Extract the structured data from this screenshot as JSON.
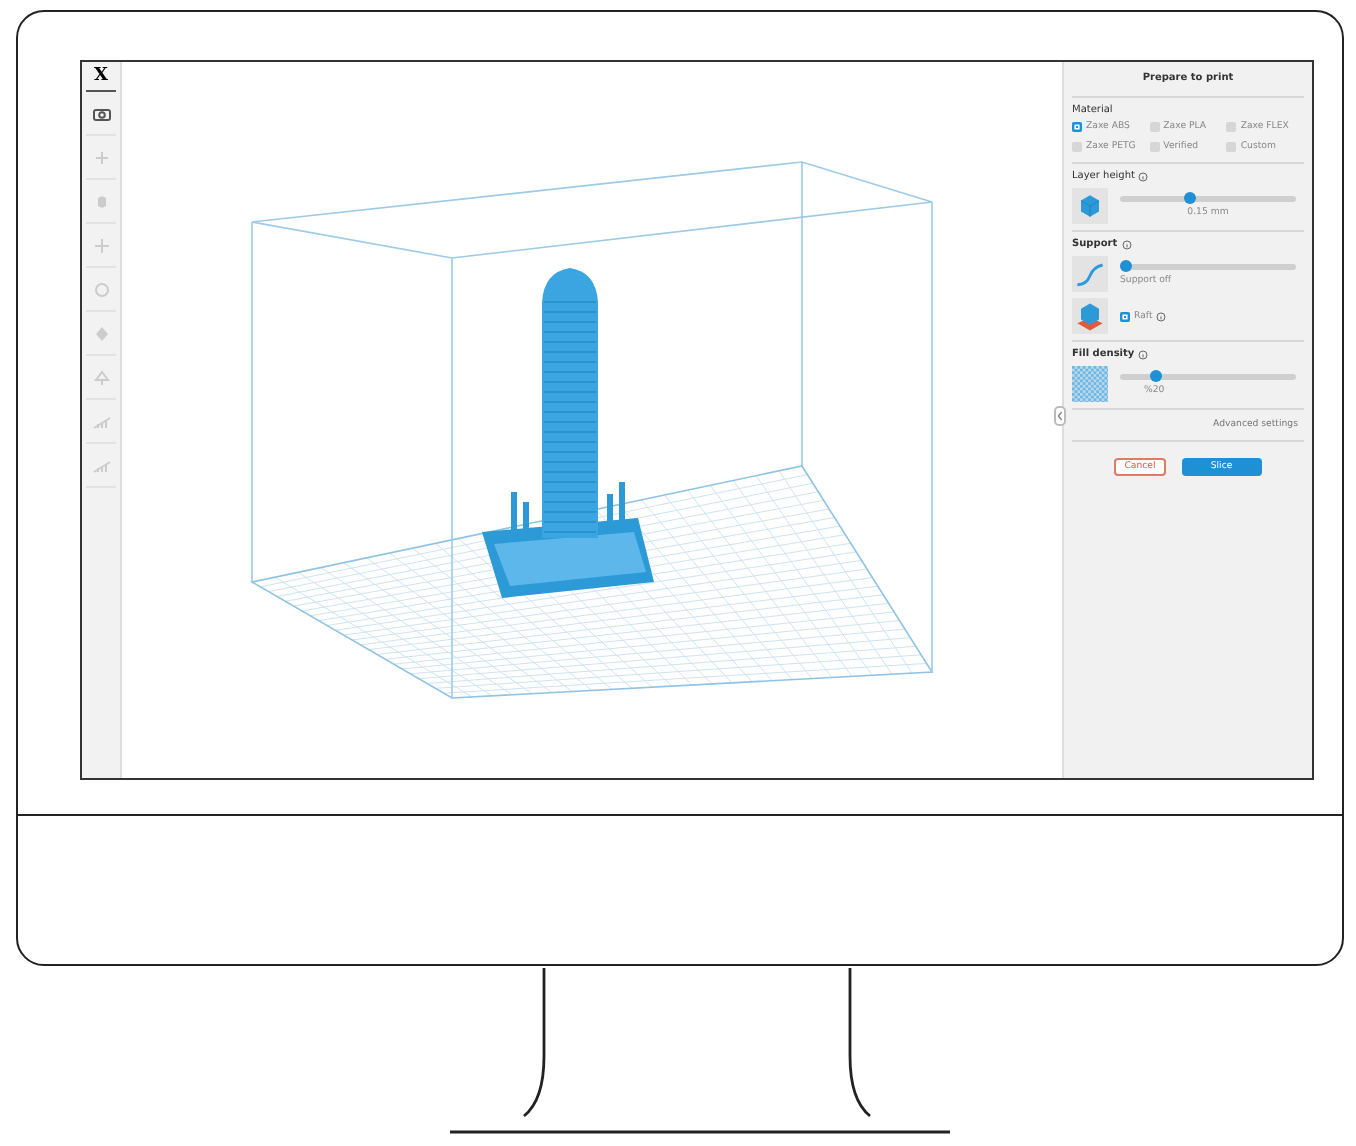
{
  "toolbar": {
    "logo": "X",
    "tools": [
      {
        "kind": "camera",
        "disabled": false
      },
      {
        "kind": "move",
        "disabled": true
      },
      {
        "kind": "rotate",
        "disabled": true
      },
      {
        "kind": "scale",
        "disabled": true
      },
      {
        "kind": "mirror",
        "disabled": true
      },
      {
        "kind": "place",
        "disabled": true
      },
      {
        "kind": "tree",
        "disabled": true
      },
      {
        "kind": "bars",
        "disabled": true
      },
      {
        "kind": "bars",
        "disabled": true
      }
    ]
  },
  "panel": {
    "title": "Prepare to print",
    "material_label": "Material",
    "materials": [
      {
        "label": "Zaxe ABS",
        "checked": true
      },
      {
        "label": "Zaxe PLA",
        "checked": false
      },
      {
        "label": "Zaxe FLEX",
        "checked": false
      },
      {
        "label": "Zaxe PETG",
        "checked": false
      },
      {
        "label": "Verified",
        "checked": false
      },
      {
        "label": "Custom",
        "checked": false
      }
    ],
    "layer_height": {
      "label": "Layer height",
      "level": 0.4,
      "reading": "0.15 mm"
    },
    "support": {
      "label": "Support",
      "level": 0.03,
      "reading": "Support off"
    },
    "raft": {
      "label": "Raft",
      "checked": true
    },
    "fill_density": {
      "label": "Fill density",
      "level": 0.2,
      "reading": "%20"
    },
    "advanced_link": "Advanced settings",
    "buttons": {
      "cancel": "Cancel",
      "slice": "Slice"
    }
  }
}
